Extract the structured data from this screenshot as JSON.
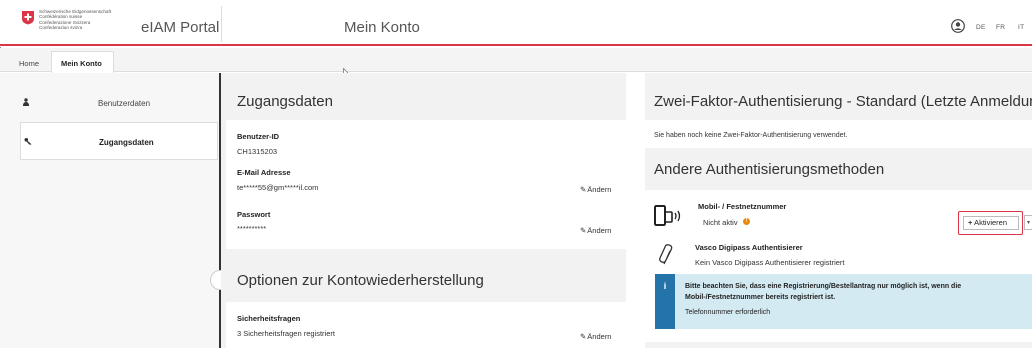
{
  "header": {
    "confederation": [
      "Schweizerische Eidgenossenschaft",
      "Confédération suisse",
      "Confederazione Svizzera",
      "Confederaziun svizra"
    ],
    "app_title": "eIAM Portal",
    "page_title": "Mein Konto",
    "languages": [
      "DE",
      "FR",
      "IT"
    ]
  },
  "breadcrumb": {
    "home": "Home",
    "active": "Mein Konto"
  },
  "nav": {
    "items": [
      {
        "label": "Benutzerdaten",
        "icon": "user-icon"
      },
      {
        "label": "Zugangsdaten",
        "icon": "key-icon",
        "active": true
      }
    ]
  },
  "access": {
    "title": "Zugangsdaten",
    "user_id_label": "Benutzer-ID",
    "user_id": "CH1315203",
    "email_label": "E-Mail Adresse",
    "email": "te*****55@gm*****il.com",
    "password_label": "Passwort",
    "password": "**********",
    "edit_label": "Ändern"
  },
  "recovery": {
    "title": "Optionen zur Kontowiederherstellung",
    "questions_label": "Sicherheitsfragen",
    "questions_value": "3 Sicherheitsfragen registriert",
    "edit_label": "Ändern"
  },
  "twofa": {
    "title": "Zwei-Faktor-Authentisierung - Standard (Letzte Anmeldung)",
    "note": "Sie haben noch keine Zwei-Faktor-Authentisierung verwendet.",
    "other_title": "Andere Authentisierungsmethoden",
    "mobile_title": "Mobil- / Festnetznummer",
    "mobile_status": "Nicht aktiv",
    "activate_label": "Aktivieren",
    "vasco_title": "Vasco Digipass Authentisierer",
    "vasco_status": "Kein Vasco Digipass Authentisierer registriert",
    "info_line1": "Bitte beachten Sie, dass eine Registrierung/Bestellantrag nur möglich ist, wenn die",
    "info_line2": "Mobil-/Festnetznummer bereits registriert ist.",
    "info_line3": "Telefonnummer erforderlich"
  },
  "colors": {
    "accent": "#dc3545",
    "info_blue": "#2574a9",
    "info_bg": "#d4eaf3",
    "warning": "#e8890c"
  }
}
